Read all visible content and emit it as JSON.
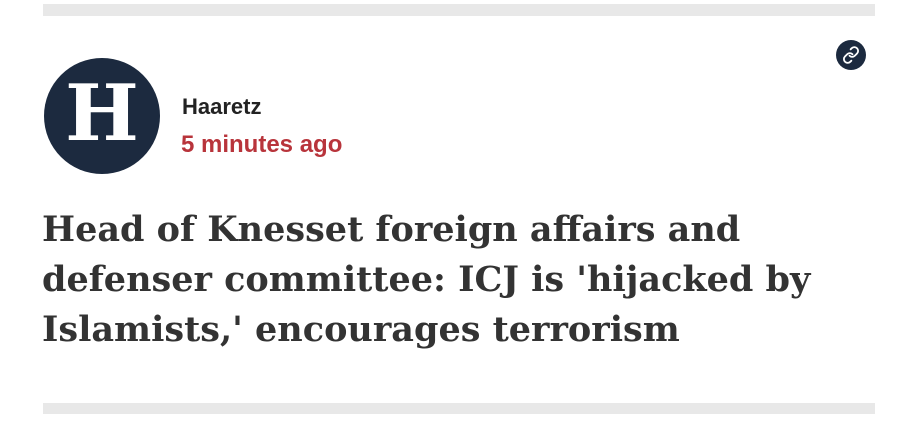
{
  "post": {
    "source": {
      "name": "Haaretz",
      "avatar_letter": "H",
      "avatar_color": "#1c2a3f"
    },
    "timestamp": "5 minutes ago",
    "timestamp_color": "#b8343b",
    "headline": "Head of Knesset foreign affairs and defenser committee: ICJ is 'hijacked by Islamists,' encourages terrorism",
    "link_icon": "link-icon"
  }
}
